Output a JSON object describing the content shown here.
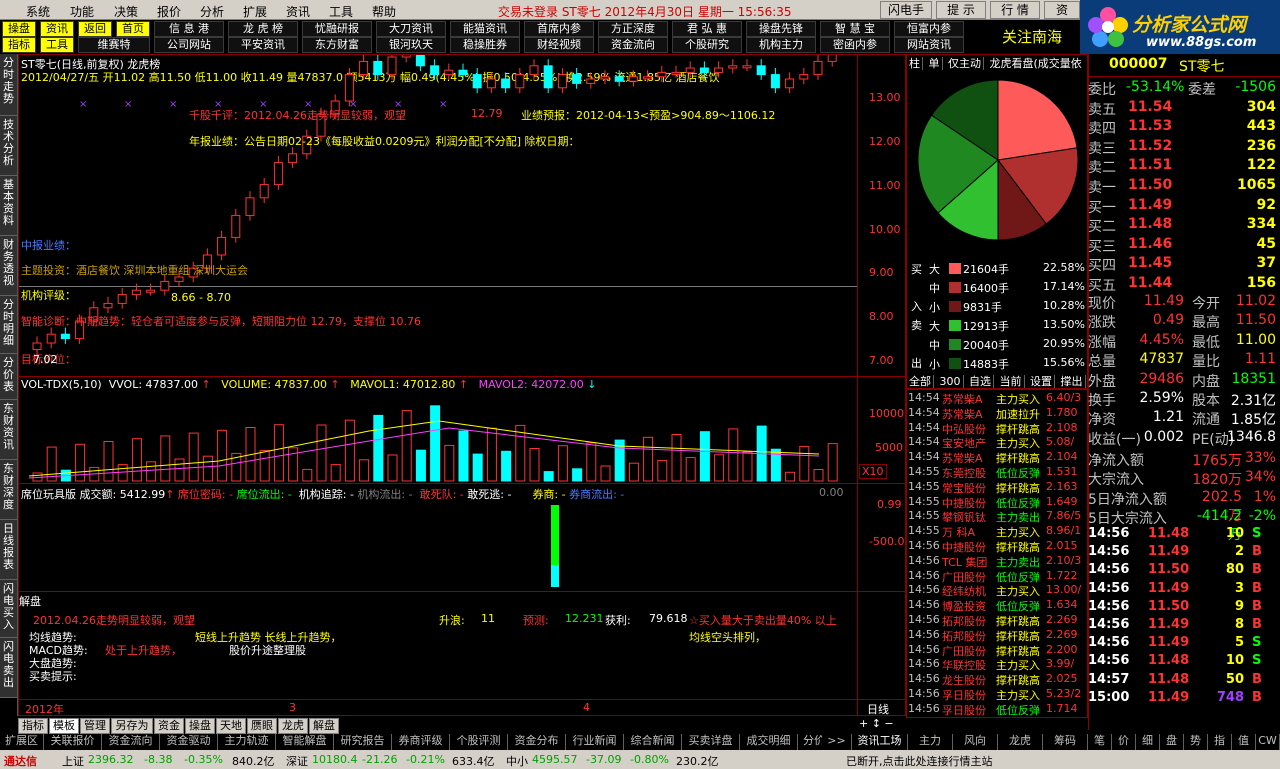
{
  "menu": {
    "items": [
      "系统",
      "功能",
      "决策",
      "报价",
      "分析",
      "扩展",
      "资讯",
      "工具",
      "帮助"
    ],
    "center": "交易未登录 ST零七 2012年4月30日 星期一 15:56:35",
    "buttons": [
      "闪电手",
      "提 示",
      "行 情",
      "资"
    ]
  },
  "toolbar": {
    "row1": [
      "操盘",
      "资讯",
      "返回",
      "首页",
      "信 息 港",
      "龙 虎 榜",
      "忧融研报",
      "大刀资讯",
      "能猫资讯",
      "首席内参",
      "方正深度",
      "君 弘 惠",
      "操盘先锋",
      "智 慧 宝",
      "恒富内参"
    ],
    "row2": [
      "指标",
      "工具",
      "维赛特",
      "公司网站",
      "平安资讯",
      "东方财富",
      "银河玖天",
      "稳操胜券",
      "财经视频",
      "资金流向",
      "个股研究",
      "机构主力",
      "密函内参",
      "网站资讯"
    ],
    "scroll": "关注南海"
  },
  "logo": {
    "title": "分析家公式网",
    "url": "www.88gs.com"
  },
  "lefttabs": [
    "分时走势",
    "技术分析",
    "基本资料",
    "财务透视",
    "分时明细",
    "分价表",
    "东财资讯",
    "东财深度",
    "日线报表",
    "闪电买入",
    "闪电卖出"
  ],
  "chart_header": {
    "name": "ST零七(日线,前复权) 龙虎榜",
    "info": "2012/04/27/五 开11.02 高11.50 低11.00 收11.49 量47837.0 额5413万 幅0.49(4.45%) 振0.50(4.55%) 换2.59% 流通1.85亿 酒店餐饮"
  },
  "annotations": {
    "a1": "千股千评：2012.04.26走势明显较弱，观望",
    "a2": "业绩预报：2012-04-13<预盈>904.89～1106.12",
    "a3": "年报业绩：公告日期02-23《每股收益0.0209元》利润分配[不分配] 除权日期：",
    "a4": "中报业绩：",
    "a5": "主题投资：酒店餐饮 深圳本地重组 深圳大运会",
    "a6": "机构评级：",
    "a7": "8.66 - 8.70",
    "a8": "智能诊断：中期趋势：轻仓者可适度参与反弹，短期阻力位 12.79，支撑位 10.76",
    "a9": "目标价位：",
    "a10": "7.02",
    "a11": "12.79"
  },
  "price_axis": [
    "13.00",
    "12.00",
    "11.00",
    "10.00",
    "9.00",
    "8.00",
    "7.00"
  ],
  "vol_header": {
    "a": "VOL-TDX(5,10)",
    "b": "VVOL: 47837.00",
    "c": "VOLUME: 47837.00",
    "d": "MAVOL1: 47012.80",
    "e": "MAVOL2: 42072.00"
  },
  "vol_axis": [
    "10000",
    "5000"
  ],
  "vol_mult": "X10",
  "ind_header": {
    "a": "席位玩具版",
    "b": "成交额: 5412.99",
    "c": "席位密码: -",
    "d": "席位流出: -",
    "e": "机构追踪: -",
    "f": "机构流出: -",
    "g": "敢死队: -",
    "h": "敢死逃: -",
    "i": "券商: -",
    "j": "券商流出: -",
    "k": "0.00"
  },
  "ind_axis": [
    "0.99",
    "-500.0"
  ],
  "jiepan": {
    "title": "解盘",
    "l1": "2012.04.26走势明显较弱，观望",
    "sz": "升浪:",
    "szv": "11",
    "yc": "预测:",
    "ycv": "12.231",
    "hl": "获利:",
    "hlv": "79.618",
    "warn": "☆买入量大于卖出量40% 以上",
    "l2a": "均线趋势:",
    "l2b": "短线上升趋势 长线上升趋势，",
    "l2c": "均线空头排列，",
    "l3a": "MACD趋势:",
    "l3b": "处于上升趋势，",
    "l3c": "股价升途整理股",
    "l4": "大盘趋势:",
    "l5": "买卖提示:"
  },
  "xaxis": {
    "year": "2012年",
    "m3": "3",
    "m4": "4",
    "period": "日线"
  },
  "pie_tabs": [
    "柱",
    "单",
    "仅主动",
    "龙虎看盘(成交量依"
  ],
  "flow": {
    "buy": [
      {
        "k": "大",
        "v": "21604手",
        "p": "22.58%",
        "c": "#ff5a5a"
      },
      {
        "k": "中",
        "v": "16400手",
        "p": "17.14%",
        "c": "#b03030"
      },
      {
        "k": "小",
        "v": "9831手",
        "p": "10.28%",
        "c": "#701818"
      }
    ],
    "sell": [
      {
        "k": "大",
        "v": "12913手",
        "p": "13.50%",
        "c": "#30c030"
      },
      {
        "k": "中",
        "v": "20040手",
        "p": "20.95%",
        "c": "#208820"
      },
      {
        "k": "小",
        "v": "14883手",
        "p": "15.56%",
        "c": "#105010"
      }
    ],
    "side_buy": "买",
    "side_sell": "卖",
    "in": "入",
    "out": "出"
  },
  "filter_tabs": [
    "全部",
    "300",
    "自选",
    "当前",
    "设置",
    "撑出",
    "扌"
  ],
  "trades": [
    [
      "14:54",
      "苏常柴A",
      "主力买入",
      "6.40/3"
    ],
    [
      "14:54",
      "苏常柴A",
      "加速拉升",
      "1.780"
    ],
    [
      "14:54",
      "中弘股份",
      "撑杆跳高",
      "2.108"
    ],
    [
      "14:54",
      "宝安地产",
      "主力买入",
      "5.08/"
    ],
    [
      "14:54",
      "苏常柴A",
      "撑杆跳高",
      "2.104"
    ],
    [
      "14:55",
      "东莞控股",
      "低位反弹",
      "1.531"
    ],
    [
      "14:55",
      "常宝股份",
      "撑杆跳高",
      "2.163"
    ],
    [
      "14:55",
      "中捷股份",
      "低位反弹",
      "1.649"
    ],
    [
      "14:55",
      "攀钢钒钛",
      "主力卖出",
      "7.86/5"
    ],
    [
      "14:55",
      "万  科A",
      "主力买入",
      "8.96/1"
    ],
    [
      "14:56",
      "中捷股份",
      "撑杆跳高",
      "2.015"
    ],
    [
      "14:56",
      "TCL 集团",
      "主力卖出",
      "2.10/3"
    ],
    [
      "14:56",
      "广田股份",
      "低位反弹",
      "1.722"
    ],
    [
      "14:56",
      "经纬纺机",
      "主力买入",
      "13.00/"
    ],
    [
      "14:56",
      "博盈投资",
      "低位反弹",
      "1.634"
    ],
    [
      "14:56",
      "拓邦股份",
      "撑杆跳高",
      "2.269"
    ],
    [
      "14:56",
      "拓邦股份",
      "撑杆跳高",
      "2.269"
    ],
    [
      "14:56",
      "广田股份",
      "撑杆跳高",
      "2.200"
    ],
    [
      "14:56",
      "华联控股",
      "主力买入",
      "3.99/"
    ],
    [
      "14:56",
      "龙生股份",
      "撑杆跳高",
      "2.025"
    ],
    [
      "14:56",
      "孚日股份",
      "主力买入",
      "5.23/2"
    ],
    [
      "14:56",
      "孚日股份",
      "低位反弹",
      "1.714"
    ]
  ],
  "quote": {
    "code": "000007",
    "name": "ST零七",
    "wb": "委比",
    "wbv": "-53.14%",
    "wc": "委差",
    "wcv": "-1506",
    "sell": [
      [
        "卖五",
        "11.54",
        "304"
      ],
      [
        "卖四",
        "11.53",
        "443"
      ],
      [
        "卖三",
        "11.52",
        "236"
      ],
      [
        "卖二",
        "11.51",
        "122"
      ],
      [
        "卖一",
        "11.50",
        "1065"
      ]
    ],
    "buy": [
      [
        "买一",
        "11.49",
        "92"
      ],
      [
        "买二",
        "11.48",
        "334"
      ],
      [
        "买三",
        "11.46",
        "45"
      ],
      [
        "买四",
        "11.45",
        "37"
      ],
      [
        "买五",
        "11.44",
        "156"
      ]
    ],
    "stats": [
      [
        "现价",
        "11.49",
        "今开",
        "11.02"
      ],
      [
        "涨跌",
        "0.49",
        "最高",
        "11.50"
      ],
      [
        "涨幅",
        "4.45%",
        "最低",
        "11.00"
      ],
      [
        "总量",
        "47837",
        "量比",
        "1.11"
      ],
      [
        "外盘",
        "29486",
        "内盘",
        "18351"
      ]
    ],
    "stats2": [
      [
        "换手",
        "2.59%",
        "股本",
        "2.31亿"
      ],
      [
        "净资",
        "1.21",
        "流通",
        "1.85亿"
      ],
      [
        "收益(一)",
        "0.002",
        "PE(动)",
        "1346.8"
      ]
    ],
    "flows": [
      [
        "净流入额",
        "1765万",
        "33%"
      ],
      [
        "大宗流入",
        "1820万",
        "34%"
      ],
      [
        "5日净流入额",
        "202.5万",
        "1%"
      ],
      [
        "5日大宗流入",
        "-414.2万",
        "-2%"
      ]
    ]
  },
  "ticks": [
    [
      "14:56",
      "11.48",
      "10",
      "S"
    ],
    [
      "14:56",
      "11.49",
      "2",
      "B"
    ],
    [
      "14:56",
      "11.50",
      "80",
      "B"
    ],
    [
      "14:56",
      "11.49",
      "3",
      "B"
    ],
    [
      "14:56",
      "11.50",
      "9",
      "B"
    ],
    [
      "14:56",
      "11.49",
      "8",
      "B"
    ],
    [
      "14:56",
      "11.49",
      "5",
      "S"
    ],
    [
      "14:56",
      "11.48",
      "10",
      "S"
    ],
    [
      "14:57",
      "11.48",
      "50",
      "B"
    ],
    [
      "15:00",
      "11.49",
      "748",
      "B"
    ]
  ],
  "bottom_tabs1": [
    "指标",
    "模板",
    "管理",
    "另存为",
    "资金",
    "操盘",
    "天地",
    "赝眼",
    "龙虎",
    "解盘"
  ],
  "bottom_tabs2": [
    "扩展区",
    "关联报价",
    "资金流向",
    "资金驱动",
    "主力轨迹",
    "智能解盘",
    "研究报告",
    "券商评级",
    "个股评测",
    "资金分布",
    "行业新闻",
    "综合新闻",
    "买卖详盘",
    "成交明细",
    "分价表"
  ],
  "bottom_right": [
    "资讯工场",
    "主力",
    "风向",
    "龙虎",
    "筹码"
  ],
  "bottom_right2": [
    "笔",
    "价",
    "细",
    "盘",
    "势",
    "指",
    "值",
    "CW"
  ],
  "status": {
    "app": "通达信",
    "sh": "上证",
    "shv": "2396.32",
    "shc": "-8.38",
    "shp": "-0.35%",
    "sha": "840.2亿",
    "sz": "深证",
    "szv": "10180.4",
    "szc": "-21.26",
    "szp": "-0.21%",
    "sza": "633.4亿",
    "zx": "中小",
    "zxv": "4595.57",
    "zxc": "-37.09",
    "zxp": "-0.80%",
    "zxa": "230.2亿",
    "msg": "已断开,点击此处连接行情主站"
  },
  "colors": {
    "up": "#ff3232",
    "down": "#00ffff",
    "border": "#8a0000",
    "yellow": "#ffff00"
  }
}
